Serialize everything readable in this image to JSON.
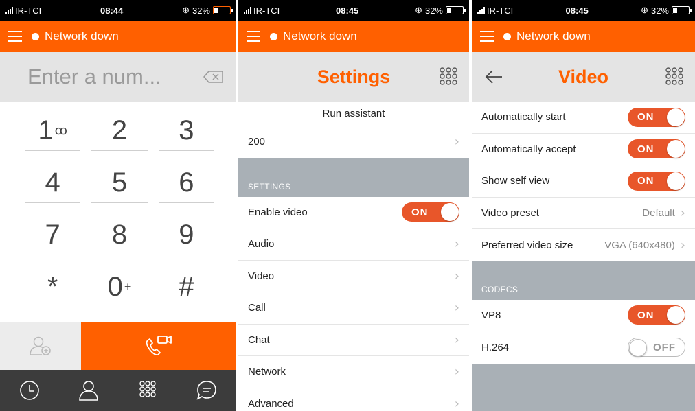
{
  "colors": {
    "accent": "#ff6000",
    "toggle_on": "#e8562a",
    "section_gray": "#a9b0b6"
  },
  "status": {
    "carrier": "IR-TCI",
    "battery": "32%",
    "times": [
      "08:44",
      "08:45",
      "08:45"
    ]
  },
  "header": {
    "network_status": "Network down"
  },
  "dialer": {
    "placeholder": "Enter a num...",
    "keys": [
      {
        "digit": "1",
        "sub": "ꝏ"
      },
      {
        "digit": "2",
        "sub": ""
      },
      {
        "digit": "3",
        "sub": ""
      },
      {
        "digit": "4",
        "sub": ""
      },
      {
        "digit": "5",
        "sub": ""
      },
      {
        "digit": "6",
        "sub": ""
      },
      {
        "digit": "7",
        "sub": ""
      },
      {
        "digit": "8",
        "sub": ""
      },
      {
        "digit": "9",
        "sub": ""
      },
      {
        "digit": "*",
        "sub": ""
      },
      {
        "digit": "0",
        "sub": "+"
      },
      {
        "digit": "#",
        "sub": ""
      }
    ],
    "tabs": [
      "history-icon",
      "contacts-icon",
      "dialpad-icon",
      "chat-icon"
    ]
  },
  "settings": {
    "title": "Settings",
    "run_assistant": "Run assistant",
    "account": "200",
    "section": "SETTINGS",
    "enable_video": {
      "label": "Enable video",
      "state": "ON"
    },
    "items": [
      "Audio",
      "Video",
      "Call",
      "Chat",
      "Network",
      "Advanced"
    ]
  },
  "video": {
    "title": "Video",
    "auto_start": {
      "label": "Automatically start",
      "state": "ON"
    },
    "auto_accept": {
      "label": "Automatically accept",
      "state": "ON"
    },
    "self_view": {
      "label": "Show self view",
      "state": "ON"
    },
    "preset": {
      "label": "Video preset",
      "value": "Default"
    },
    "size": {
      "label": "Preferred video size",
      "value": "VGA (640x480)"
    },
    "codecs_section": "CODECS",
    "vp8": {
      "label": "VP8",
      "state": "ON"
    },
    "h264": {
      "label": "H.264",
      "state": "OFF"
    }
  }
}
